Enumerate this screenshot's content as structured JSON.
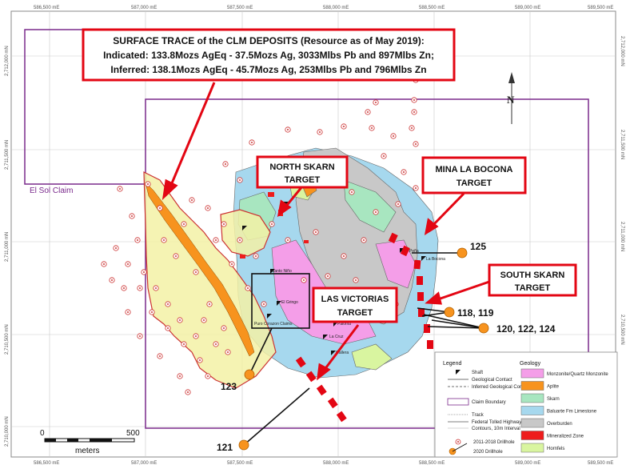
{
  "grid": {
    "top_labels": [
      "586,500 mE",
      "587,000 mE",
      "587,500 mE",
      "588,000 mE",
      "588,500 mE",
      "589,000 mE",
      "589,500 mE"
    ],
    "bottom_labels": [
      "586,500 mE",
      "587,000 mE",
      "587,500 mE",
      "588,000 mE",
      "588,500 mE",
      "589,000 mE",
      "589,500 mE"
    ],
    "left_labels": [
      "2,712,000 mN",
      "2,711,500 mN",
      "2,711,000 mN",
      "2,710,500 mN",
      "2,710,000 mN"
    ],
    "right_labels": [
      "2,712,000 mN",
      "2,711,500 mN",
      "2,711,000 mN",
      "2,710,500 mN"
    ]
  },
  "title_box": {
    "line1": "SURFACE TRACE of the CLM DEPOSITS (Resource as of May 2019):",
    "line2": "Indicated: 133.8Mozs AgEq  - 37.5Mozs Ag, 3033Mlbs Pb and 897Mlbs Zn;",
    "line3": "Inferred: 138.1Mozs AgEq  -   45.7Mozs Ag, 253Mlbs Pb and 796Mlbs Zn"
  },
  "callouts": {
    "north_skarn": [
      "NORTH SKARN",
      "TARGET"
    ],
    "mina_la_bocona": [
      "MINA LA BOCONA",
      "TARGET"
    ],
    "south_skarn": [
      "SOUTH SKARN",
      "TARGET"
    ],
    "las_victorias": [
      "LAS VICTORIAS",
      "TARGET"
    ]
  },
  "claim_label": "El Sol Claim",
  "hole_labels": {
    "h125": "125",
    "h118": "118, 119",
    "h120": "120, 122, 124",
    "h123": "123",
    "h121": "121"
  },
  "place_names": {
    "santo_nino": "Santo Niño",
    "el_gringo": "El Gringo",
    "puro_corazon": "Puro Corazon Claims",
    "paloma": "Paloma",
    "la_cruz": "La Cruz",
    "gallera": "Gallera",
    "la_bocona": "La Bocona",
    "pena": "Peña"
  },
  "north_arrow": "N",
  "scale_bar": {
    "start": "0",
    "end": "500",
    "unit": "meters"
  },
  "legend": {
    "title": "Legend",
    "items": [
      "Shaft",
      "Geological Contact",
      "Inferred Geological Contact",
      "Claim Boundary",
      "Track",
      "Federal Tolled Highway",
      "Contours, 10m Interval",
      "2011-2018 Drillhole",
      "2020 Drillhole"
    ],
    "geology_title": "Geology",
    "geology": [
      {
        "label": "Monzonite/Quartz Monzonite",
        "color": "#f49ee8"
      },
      {
        "label": "Aplite",
        "color": "#f7931e"
      },
      {
        "label": "Skarn",
        "color": "#a8e6c0"
      },
      {
        "label": "Baluarte Fm Limestone",
        "color": "#a6d8ee"
      },
      {
        "label": "Overburden",
        "color": "#c8c8c8"
      },
      {
        "label": "Mineralized Zone",
        "color": "#ee1c1c"
      },
      {
        "label": "Hornfels",
        "color": "#d9f5a0"
      }
    ]
  },
  "colors": {
    "callout_red": "#e30613",
    "claim_purple": "#7a2a8c",
    "drill_orange": "#f7931e",
    "target_red": "#e30613"
  }
}
